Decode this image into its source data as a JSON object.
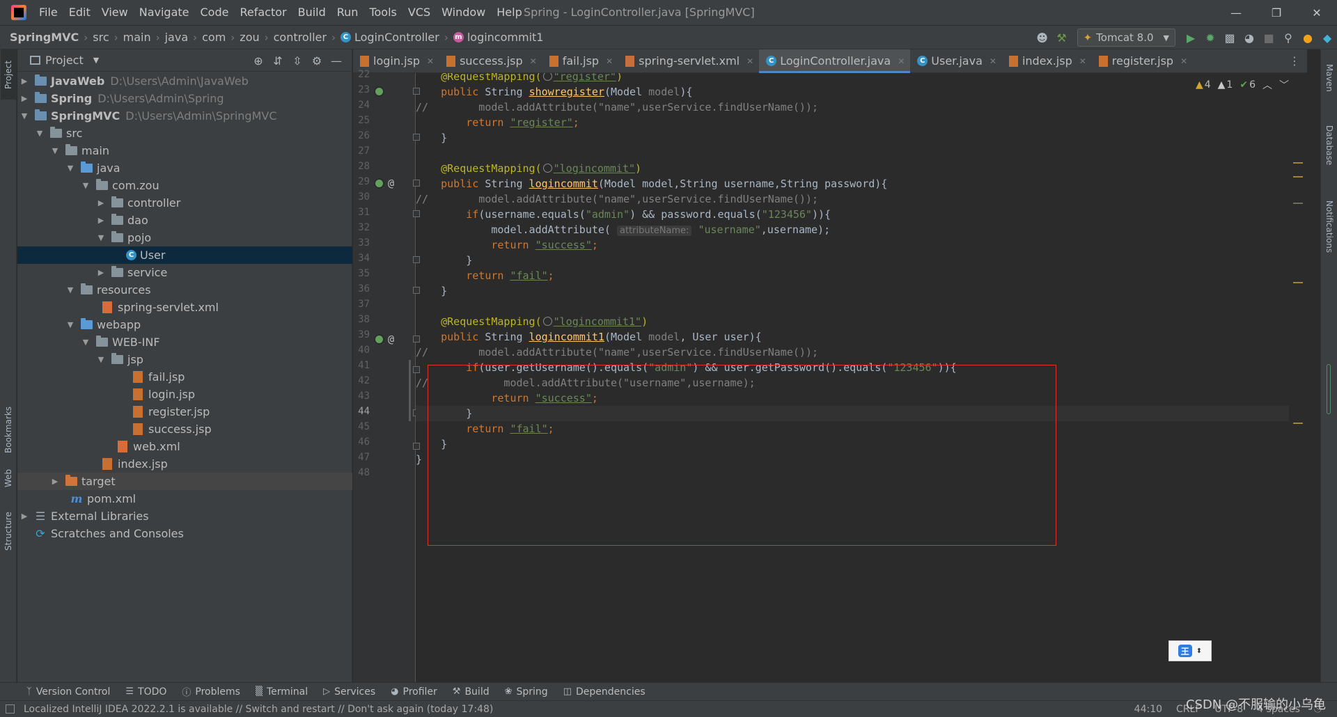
{
  "menubar": {
    "items": [
      "File",
      "Edit",
      "View",
      "Navigate",
      "Code",
      "Refactor",
      "Build",
      "Run",
      "Tools",
      "VCS",
      "Window",
      "Help"
    ],
    "title": "Spring - LoginController.java [SpringMVC]",
    "win_buttons": [
      "—",
      "❐",
      "✕"
    ]
  },
  "navbar": {
    "breadcrumbs": [
      "SpringMVC",
      "src",
      "main",
      "java",
      "com",
      "zou",
      "controller",
      "LoginController",
      "logincommit1"
    ],
    "run_config": "Tomcat 8.0"
  },
  "left_strip": {
    "project": "Project",
    "bookmarks": "Bookmarks",
    "web": "Web",
    "structure": "Structure"
  },
  "right_strip": {
    "maven": "Maven",
    "database": "Database",
    "notifications": "Notifications"
  },
  "project_panel": {
    "title": "Project",
    "tree": [
      {
        "label": "JavaWeb",
        "path": "D:\\Users\\Admin\\JavaWeb",
        "bold": true
      },
      {
        "label": "Spring",
        "path": "D:\\Users\\Admin\\Spring",
        "bold": true
      },
      {
        "label": "SpringMVC",
        "path": "D:\\Users\\Admin\\SpringMVC",
        "bold": true
      },
      {
        "label": "src"
      },
      {
        "label": "main"
      },
      {
        "label": "java"
      },
      {
        "label": "com.zou"
      },
      {
        "label": "controller"
      },
      {
        "label": "dao"
      },
      {
        "label": "pojo"
      },
      {
        "label": "User"
      },
      {
        "label": "service"
      },
      {
        "label": "resources"
      },
      {
        "label": "spring-servlet.xml"
      },
      {
        "label": "webapp"
      },
      {
        "label": "WEB-INF"
      },
      {
        "label": "jsp"
      },
      {
        "label": "fail.jsp"
      },
      {
        "label": "login.jsp"
      },
      {
        "label": "register.jsp"
      },
      {
        "label": "success.jsp"
      },
      {
        "label": "web.xml"
      },
      {
        "label": "index.jsp"
      },
      {
        "label": "target"
      },
      {
        "label": "pom.xml"
      },
      {
        "label": "External Libraries"
      },
      {
        "label": "Scratches and Consoles"
      }
    ]
  },
  "editor": {
    "tabs": [
      "login.jsp",
      "success.jsp",
      "fail.jsp",
      "spring-servlet.xml",
      "LoginController.java",
      "User.java",
      "index.jsp",
      "register.jsp"
    ],
    "active_tab": "LoginController.java",
    "inspections": {
      "warnings": "4",
      "weak_warnings": "1",
      "ok": "6"
    },
    "line_numbers": [
      "22",
      "23",
      "24",
      "25",
      "26",
      "27",
      "28",
      "29",
      "30",
      "31",
      "32",
      "33",
      "34",
      "35",
      "36",
      "37",
      "38",
      "39",
      "40",
      "41",
      "42",
      "43",
      "44",
      "45",
      "46",
      "47",
      "48"
    ],
    "current_line": "44",
    "code": {
      "l22_ann": "@RequestMapping(",
      "l22_str": "\"register\"",
      "l22_end": ")",
      "l23_a": "public ",
      "l23_b": "String ",
      "l23_fn": "showregister",
      "l23_c": "(Model ",
      "l23_d": "model",
      "l23_e": "){",
      "l24": "//        model.addAttribute(\"name\",userService.findUserName());",
      "l25_kw": "        return ",
      "l25_str": "\"register\"",
      "l25_end": ";",
      "l26": "    }",
      "l28_ann": "    @RequestMapping(",
      "l28_str": "\"logincommit\"",
      "l28_end": ")",
      "l29_a": "    public ",
      "l29_b": "String ",
      "l29_fn": "logincommit",
      "l29_c": "(Model model,String username,String password){",
      "l30": "//        model.addAttribute(\"name\",userService.findUserName());",
      "l31_kw": "        if",
      "l31_a": "(username.equals(",
      "l31_s1": "\"admin\"",
      "l31_b": ") && password.equals(",
      "l31_s2": "\"123456\"",
      "l31_c": ")){",
      "l32_a": "            model.addAttribute( ",
      "l32_hint": "attributeName:",
      "l32_s": " \"username\"",
      "l32_b": ",username);",
      "l33_kw": "            return ",
      "l33_s": "\"success\"",
      "l33_e": ";",
      "l34": "        }",
      "l35_kw": "        return ",
      "l35_s": "\"fail\"",
      "l35_e": ";",
      "l36": "    }",
      "l38_ann": "    @RequestMapping(",
      "l38_str": "\"logincommit1\"",
      "l38_end": ")",
      "l39_a": "    public ",
      "l39_b": "String ",
      "l39_fn": "logincommit1",
      "l39_c": "(Model ",
      "l39_d": "model",
      "l39_e": ", User user){",
      "l40": "//        model.addAttribute(\"name\",userService.findUserName());",
      "l41_kw": "        if",
      "l41_a": "(user.getUsername().equals(",
      "l41_s1": "\"admin\"",
      "l41_b": ") && user.getPassword().equals(",
      "l41_s2": "\"123456\"",
      "l41_c": ")){",
      "l42": "//            model.addAttribute(\"username\",username);",
      "l43_kw": "            return ",
      "l43_s": "\"success\"",
      "l43_e": ";",
      "l44": "        }",
      "l45_kw": "        return ",
      "l45_s": "\"fail\"",
      "l45_e": ";",
      "l46": "    }",
      "l47": "}"
    }
  },
  "bottom_toolbar": [
    "Version Control",
    "TODO",
    "Problems",
    "Terminal",
    "Services",
    "Profiler",
    "Build",
    "Spring",
    "Dependencies"
  ],
  "statusbar": {
    "message": "Localized IntelliJ IDEA 2022.2.1 is available // Switch and restart // Don't ask again (today 17:48)",
    "position": "44:10",
    "line_sep": "CRLF",
    "encoding": "UTF-8",
    "indent": "4 spaces"
  },
  "watermark": "CSDN @不服输的小乌龟",
  "ime": {
    "label": "王"
  }
}
